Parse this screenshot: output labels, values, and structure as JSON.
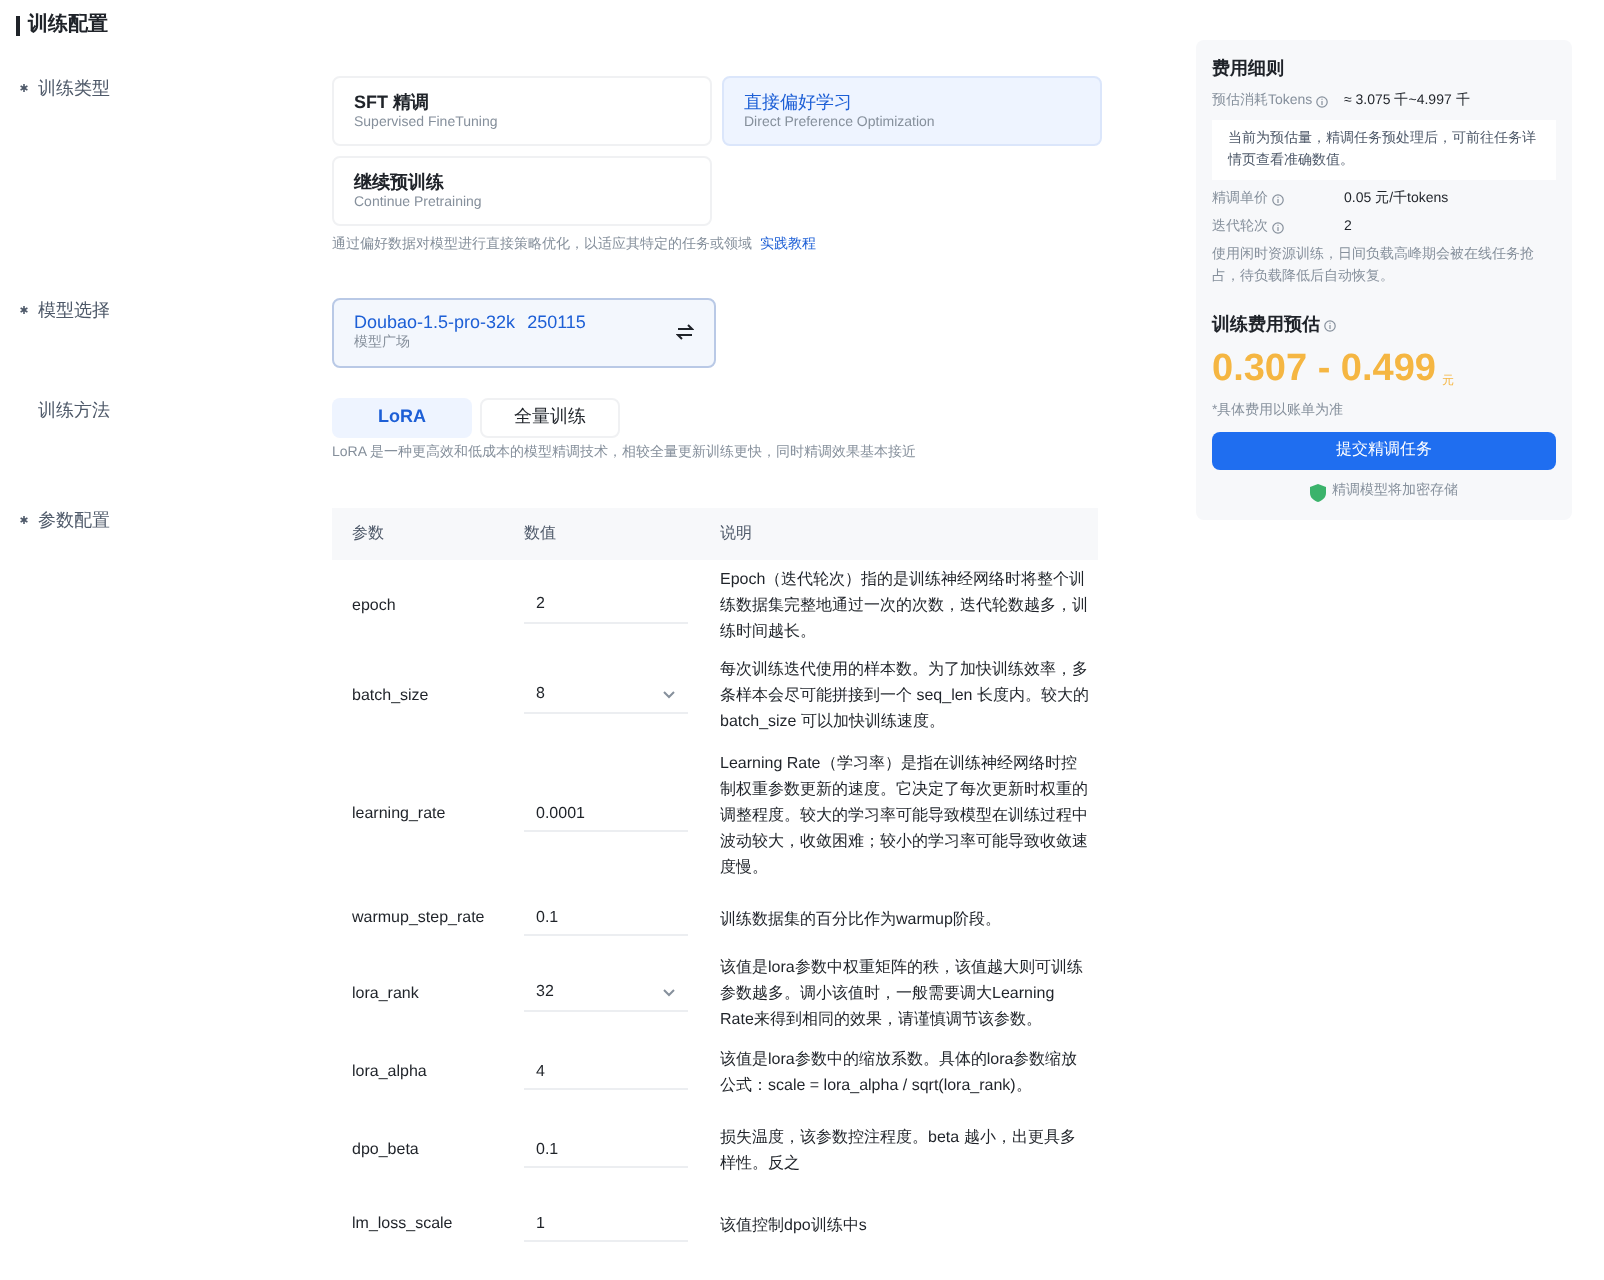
{
  "section_title": "训练配置",
  "training_type": {
    "label": "训练类型",
    "required": true,
    "options": [
      {
        "title": "SFT 精调",
        "subtitle": "Supervised FineTuning",
        "selected": false
      },
      {
        "title": "直接偏好学习",
        "subtitle": "Direct Preference Optimization",
        "selected": true
      },
      {
        "title": "继续预训练",
        "subtitle": "Continue Pretraining",
        "selected": false
      }
    ],
    "hint": "通过偏好数据对模型进行直接策略优化，以适应其特定的任务或领域",
    "hint_link": "实践教程"
  },
  "model": {
    "label": "模型选择",
    "required": true,
    "name": "Doubao-1.5-pro-32k",
    "version": "250115",
    "source": "模型广场"
  },
  "method": {
    "label": "训练方法",
    "required": false,
    "options": [
      {
        "label": "LoRA",
        "selected": true
      },
      {
        "label": "全量训练",
        "selected": false
      }
    ],
    "hint": "LoRA 是一种更高效和低成本的模型精调技术，相较全量更新训练更快，同时精调效果基本接近"
  },
  "params": {
    "label": "参数配置",
    "required": true,
    "columns": [
      "参数",
      "数值",
      "说明"
    ],
    "rows": [
      {
        "name": "epoch",
        "value": "2",
        "kind": "input",
        "description": "Epoch（迭代轮次）指的是训练神经网络时将整个训练数据集完整地通过一次的次数，迭代轮数越多，训练时间越长。"
      },
      {
        "name": "batch_size",
        "value": "8",
        "kind": "select",
        "description": "每次训练迭代使用的样本数。为了加快训练效率，多条样本会尽可能拼接到一个 seq_len 长度内。较大的 batch_size 可以加快训练速度。"
      },
      {
        "name": "learning_rate",
        "value": "0.0001",
        "kind": "input",
        "description": "Learning Rate（学习率）是指在训练神经网络时控制权重参数更新的速度。它决定了每次更新时权重的调整程度。较大的学习率可能导致模型在训练过程中波动较大，收敛困难；较小的学习率可能导致收敛速度慢。"
      },
      {
        "name": "warmup_step_rate",
        "value": "0.1",
        "kind": "input",
        "description": "训练数据集的百分比作为warmup阶段。"
      },
      {
        "name": "lora_rank",
        "value": "32",
        "kind": "select",
        "description": "该值是lora参数中权重矩阵的秩，该值越大则可训练参数越多。调小该值时，一般需要调大Learning Rate来得到相同的效果，请谨慎调节该参数。"
      },
      {
        "name": "lora_alpha",
        "value": "4",
        "kind": "input",
        "description": "该值是lora参数中的缩放系数。具体的lora参数缩放公式：scale = lora_alpha / sqrt(lora_rank)。"
      },
      {
        "name": "dpo_beta",
        "value": "0.1",
        "kind": "input",
        "description": "损失温度，该参数控注程度。beta 越小，出更具多样性。反之"
      },
      {
        "name": "lm_loss_scale",
        "value": "1",
        "kind": "input",
        "description": "该值控制dpo训练中s"
      }
    ]
  },
  "cost": {
    "title": "费用细则",
    "tokens_label": "预估消耗Tokens",
    "tokens_value": "≈ 3.075 千~4.997 千",
    "notice": "当前为预估量，精调任务预处理后，可前往任务详情页查看准确数值。",
    "price_label": "精调单价",
    "price_value": "0.05 元/千tokens",
    "epochs_label": "迭代轮次",
    "epochs_value": "2",
    "idle_note": "使用闲时资源训练，日间负载高峰期会被在线任务抢占，待负载降低后自动恢复。",
    "estimate_title": "训练费用预估",
    "estimate": "0.307 - 0.499",
    "unit": "元",
    "disclaimer": "*具体费用以账单为准",
    "submit": "提交精调任务",
    "security": "精调模型将加密存储"
  }
}
